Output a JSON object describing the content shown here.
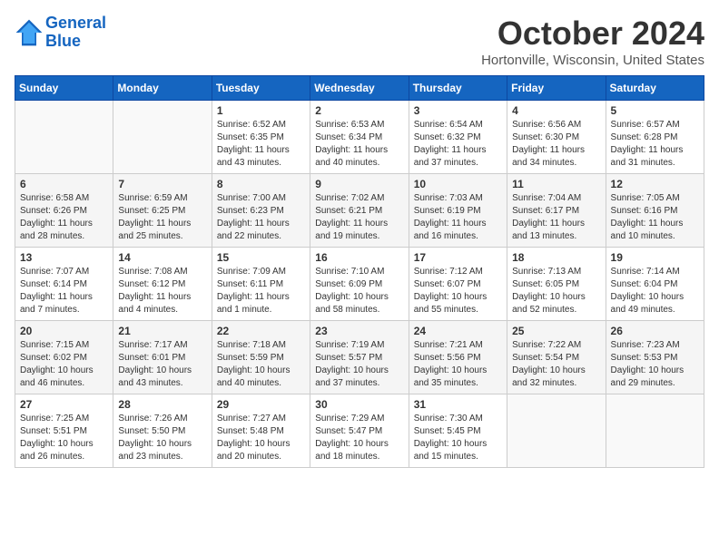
{
  "header": {
    "logo_line1": "General",
    "logo_line2": "Blue",
    "month": "October 2024",
    "location": "Hortonville, Wisconsin, United States"
  },
  "days_of_week": [
    "Sunday",
    "Monday",
    "Tuesday",
    "Wednesday",
    "Thursday",
    "Friday",
    "Saturday"
  ],
  "weeks": [
    [
      {
        "num": "",
        "content": ""
      },
      {
        "num": "",
        "content": ""
      },
      {
        "num": "1",
        "content": "Sunrise: 6:52 AM\nSunset: 6:35 PM\nDaylight: 11 hours and 43 minutes."
      },
      {
        "num": "2",
        "content": "Sunrise: 6:53 AM\nSunset: 6:34 PM\nDaylight: 11 hours and 40 minutes."
      },
      {
        "num": "3",
        "content": "Sunrise: 6:54 AM\nSunset: 6:32 PM\nDaylight: 11 hours and 37 minutes."
      },
      {
        "num": "4",
        "content": "Sunrise: 6:56 AM\nSunset: 6:30 PM\nDaylight: 11 hours and 34 minutes."
      },
      {
        "num": "5",
        "content": "Sunrise: 6:57 AM\nSunset: 6:28 PM\nDaylight: 11 hours and 31 minutes."
      }
    ],
    [
      {
        "num": "6",
        "content": "Sunrise: 6:58 AM\nSunset: 6:26 PM\nDaylight: 11 hours and 28 minutes."
      },
      {
        "num": "7",
        "content": "Sunrise: 6:59 AM\nSunset: 6:25 PM\nDaylight: 11 hours and 25 minutes."
      },
      {
        "num": "8",
        "content": "Sunrise: 7:00 AM\nSunset: 6:23 PM\nDaylight: 11 hours and 22 minutes."
      },
      {
        "num": "9",
        "content": "Sunrise: 7:02 AM\nSunset: 6:21 PM\nDaylight: 11 hours and 19 minutes."
      },
      {
        "num": "10",
        "content": "Sunrise: 7:03 AM\nSunset: 6:19 PM\nDaylight: 11 hours and 16 minutes."
      },
      {
        "num": "11",
        "content": "Sunrise: 7:04 AM\nSunset: 6:17 PM\nDaylight: 11 hours and 13 minutes."
      },
      {
        "num": "12",
        "content": "Sunrise: 7:05 AM\nSunset: 6:16 PM\nDaylight: 11 hours and 10 minutes."
      }
    ],
    [
      {
        "num": "13",
        "content": "Sunrise: 7:07 AM\nSunset: 6:14 PM\nDaylight: 11 hours and 7 minutes."
      },
      {
        "num": "14",
        "content": "Sunrise: 7:08 AM\nSunset: 6:12 PM\nDaylight: 11 hours and 4 minutes."
      },
      {
        "num": "15",
        "content": "Sunrise: 7:09 AM\nSunset: 6:11 PM\nDaylight: 11 hours and 1 minute."
      },
      {
        "num": "16",
        "content": "Sunrise: 7:10 AM\nSunset: 6:09 PM\nDaylight: 10 hours and 58 minutes."
      },
      {
        "num": "17",
        "content": "Sunrise: 7:12 AM\nSunset: 6:07 PM\nDaylight: 10 hours and 55 minutes."
      },
      {
        "num": "18",
        "content": "Sunrise: 7:13 AM\nSunset: 6:05 PM\nDaylight: 10 hours and 52 minutes."
      },
      {
        "num": "19",
        "content": "Sunrise: 7:14 AM\nSunset: 6:04 PM\nDaylight: 10 hours and 49 minutes."
      }
    ],
    [
      {
        "num": "20",
        "content": "Sunrise: 7:15 AM\nSunset: 6:02 PM\nDaylight: 10 hours and 46 minutes."
      },
      {
        "num": "21",
        "content": "Sunrise: 7:17 AM\nSunset: 6:01 PM\nDaylight: 10 hours and 43 minutes."
      },
      {
        "num": "22",
        "content": "Sunrise: 7:18 AM\nSunset: 5:59 PM\nDaylight: 10 hours and 40 minutes."
      },
      {
        "num": "23",
        "content": "Sunrise: 7:19 AM\nSunset: 5:57 PM\nDaylight: 10 hours and 37 minutes."
      },
      {
        "num": "24",
        "content": "Sunrise: 7:21 AM\nSunset: 5:56 PM\nDaylight: 10 hours and 35 minutes."
      },
      {
        "num": "25",
        "content": "Sunrise: 7:22 AM\nSunset: 5:54 PM\nDaylight: 10 hours and 32 minutes."
      },
      {
        "num": "26",
        "content": "Sunrise: 7:23 AM\nSunset: 5:53 PM\nDaylight: 10 hours and 29 minutes."
      }
    ],
    [
      {
        "num": "27",
        "content": "Sunrise: 7:25 AM\nSunset: 5:51 PM\nDaylight: 10 hours and 26 minutes."
      },
      {
        "num": "28",
        "content": "Sunrise: 7:26 AM\nSunset: 5:50 PM\nDaylight: 10 hours and 23 minutes."
      },
      {
        "num": "29",
        "content": "Sunrise: 7:27 AM\nSunset: 5:48 PM\nDaylight: 10 hours and 20 minutes."
      },
      {
        "num": "30",
        "content": "Sunrise: 7:29 AM\nSunset: 5:47 PM\nDaylight: 10 hours and 18 minutes."
      },
      {
        "num": "31",
        "content": "Sunrise: 7:30 AM\nSunset: 5:45 PM\nDaylight: 10 hours and 15 minutes."
      },
      {
        "num": "",
        "content": ""
      },
      {
        "num": "",
        "content": ""
      }
    ]
  ]
}
